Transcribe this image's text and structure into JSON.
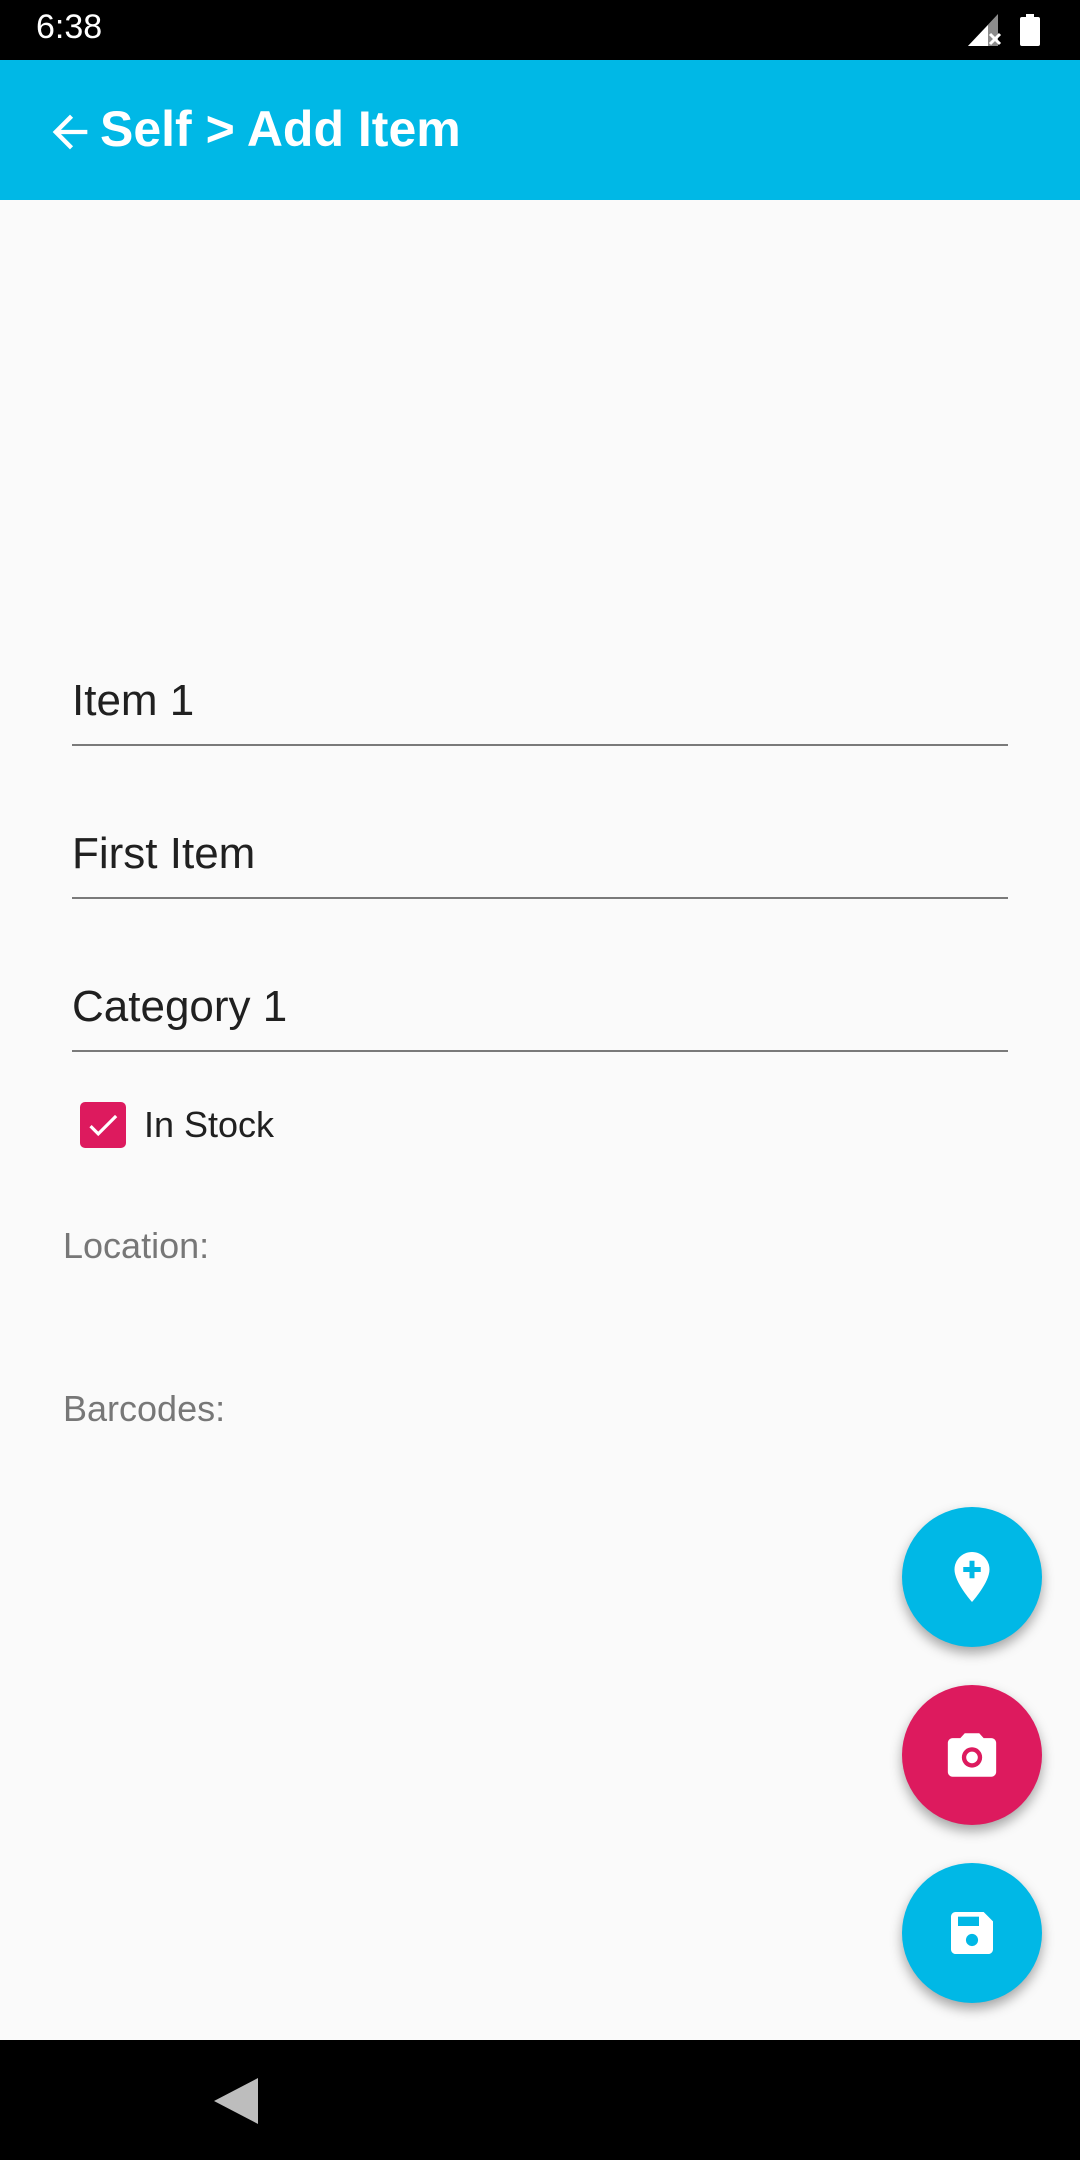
{
  "status_bar": {
    "time": "6:38",
    "icons": [
      "signal-off-icon",
      "battery-icon"
    ]
  },
  "app_bar": {
    "title": "Self > Add Item",
    "back_icon": "arrow-back-icon"
  },
  "form": {
    "name_value": "Item 1",
    "description_value": "First Item",
    "category_value": "Category 1",
    "in_stock_label": "In Stock",
    "in_stock_checked": true,
    "location_label": "Location:",
    "barcodes_label": "Barcodes:"
  },
  "fabs": [
    {
      "icon": "add-location-icon",
      "color": "#00b8e6"
    },
    {
      "icon": "camera-icon",
      "color": "#dd1a5e"
    },
    {
      "icon": "save-icon",
      "color": "#00b8e6"
    }
  ],
  "colors": {
    "primary": "#00b8e6",
    "accent": "#dd1a5e"
  }
}
